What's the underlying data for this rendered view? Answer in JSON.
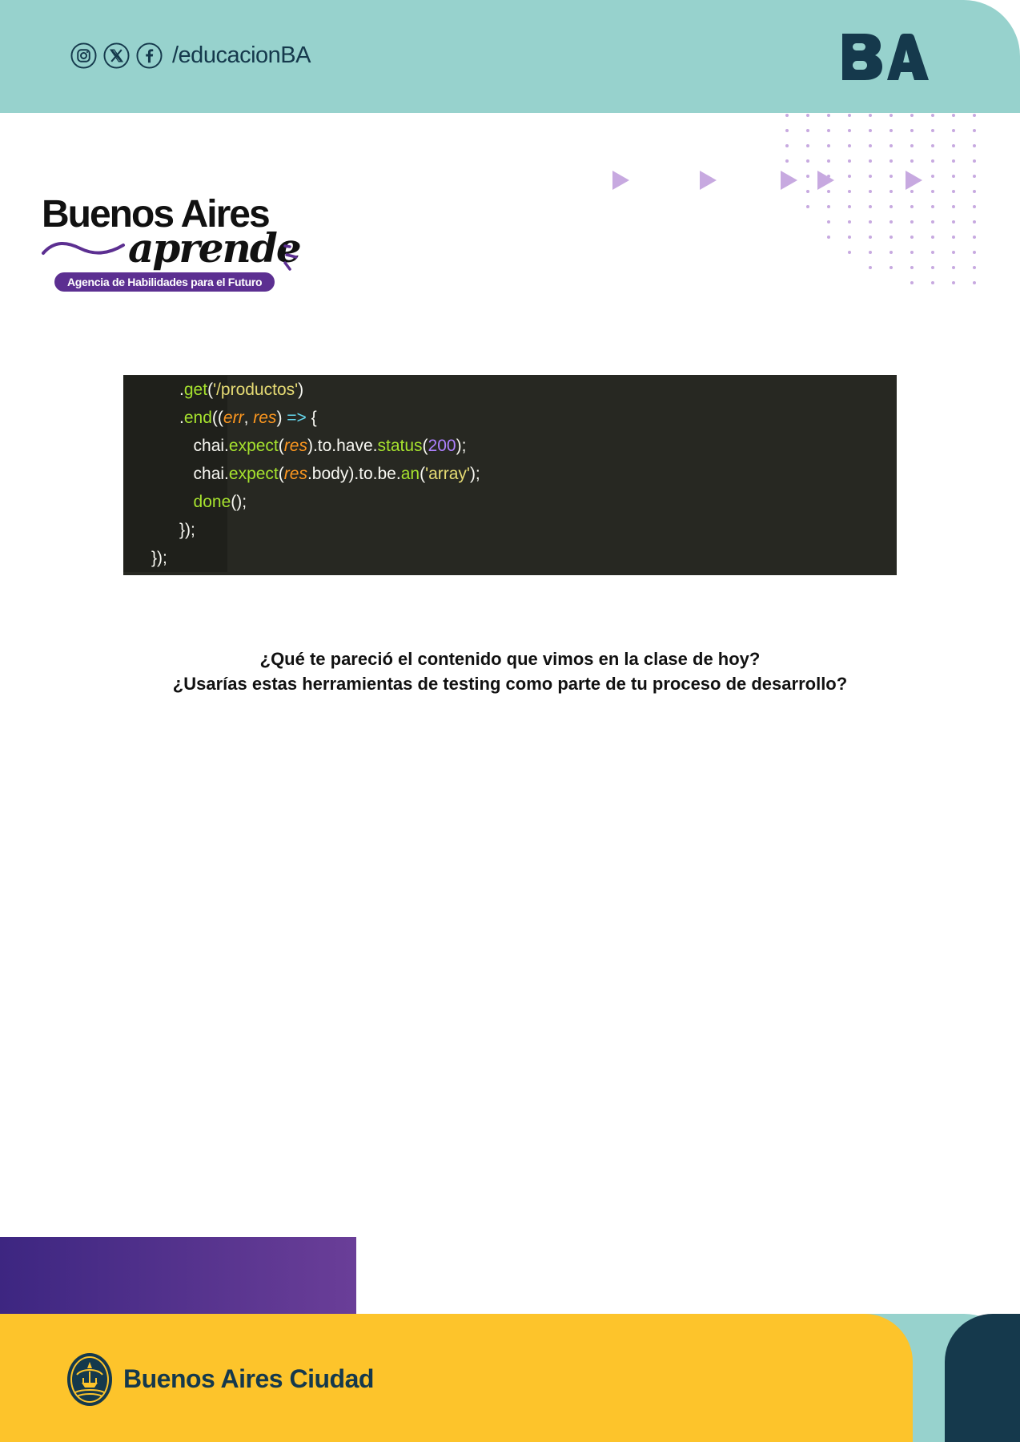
{
  "header": {
    "handle": "/educacionBA",
    "social_icons": [
      "instagram-icon",
      "x-icon",
      "facebook-icon"
    ],
    "ba_logo_text": "BA",
    "band_color": "#97d2cd"
  },
  "brand": {
    "line1": "Buenos Aires",
    "line2": "aprende",
    "tagline": "Agencia de Habilidades para el Futuro",
    "accent_color": "#5c2f91"
  },
  "code": {
    "lines": [
      {
        "indent": "            ",
        "tokens": [
          {
            "t": ".",
            "c": ""
          },
          {
            "t": "get",
            "c": "green"
          },
          {
            "t": "(",
            "c": ""
          },
          {
            "t": "'/productos'",
            "c": "yellow"
          },
          {
            "t": ")",
            "c": ""
          }
        ]
      },
      {
        "indent": "            ",
        "tokens": [
          {
            "t": ".",
            "c": ""
          },
          {
            "t": "end",
            "c": "green"
          },
          {
            "t": "((",
            "c": ""
          },
          {
            "t": "err",
            "c": "orange"
          },
          {
            "t": ", ",
            "c": ""
          },
          {
            "t": "res",
            "c": "orange"
          },
          {
            "t": ") ",
            "c": ""
          },
          {
            "t": "=>",
            "c": "cyan"
          },
          {
            "t": " {",
            "c": ""
          }
        ]
      },
      {
        "indent": "               ",
        "tokens": [
          {
            "t": "chai.",
            "c": ""
          },
          {
            "t": "expect",
            "c": "green"
          },
          {
            "t": "(",
            "c": ""
          },
          {
            "t": "res",
            "c": "orange"
          },
          {
            "t": ").to.have.",
            "c": ""
          },
          {
            "t": "status",
            "c": "green"
          },
          {
            "t": "(",
            "c": ""
          },
          {
            "t": "200",
            "c": "purple"
          },
          {
            "t": ");",
            "c": ""
          }
        ]
      },
      {
        "indent": "               ",
        "tokens": [
          {
            "t": "chai.",
            "c": ""
          },
          {
            "t": "expect",
            "c": "green"
          },
          {
            "t": "(",
            "c": ""
          },
          {
            "t": "res",
            "c": "orange"
          },
          {
            "t": ".body).to.be.",
            "c": ""
          },
          {
            "t": "an",
            "c": "green"
          },
          {
            "t": "(",
            "c": ""
          },
          {
            "t": "'array'",
            "c": "yellow"
          },
          {
            "t": ");",
            "c": ""
          }
        ]
      },
      {
        "indent": "               ",
        "tokens": [
          {
            "t": "done",
            "c": "green"
          },
          {
            "t": "();",
            "c": ""
          }
        ]
      },
      {
        "indent": "            ",
        "tokens": [
          {
            "t": "});",
            "c": ""
          }
        ]
      },
      {
        "indent": "      ",
        "tokens": [
          {
            "t": "});",
            "c": ""
          }
        ]
      }
    ]
  },
  "questions": {
    "q1": "¿Qué te pareció el contenido que vimos en la clase de hoy?",
    "q2": "¿Usarías estas herramientas de testing como parte de tu proceso de desarrollo?"
  },
  "footer": {
    "city_name": "Buenos Aires Ciudad",
    "yellow": "#fdc42b",
    "navy": "#15394c"
  }
}
